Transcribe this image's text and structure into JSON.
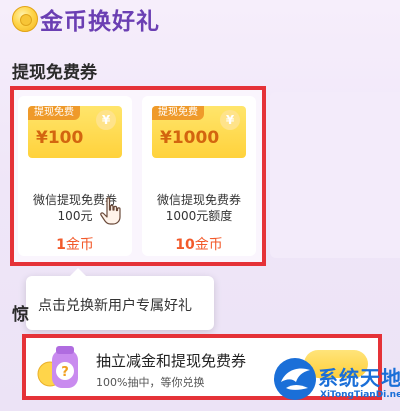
{
  "header": {
    "title": "金币换好礼",
    "icon": "coin-icon"
  },
  "section": {
    "title": "提现免费券"
  },
  "cards": [
    {
      "tag": "提现免费",
      "amount": "¥100",
      "name": "微信提现免费券",
      "sub": "100元",
      "price_num": "1",
      "price_unit": "金币"
    },
    {
      "tag": "提现免费",
      "amount": "¥1000",
      "name": "微信提现免费券",
      "sub": "1000元额度",
      "price_num": "10",
      "price_unit": "金币"
    }
  ],
  "ticket_symbol": "¥",
  "tooltip": {
    "text": "点击兑换新用户专属好礼"
  },
  "partial_section": {
    "title": "惊"
  },
  "lottery": {
    "title": "抽立减金和提现免费券",
    "sub": "100%抽中，等你兑换"
  },
  "watermark": {
    "title": "系统天地",
    "url": "XiTongTianDi.net"
  },
  "colors": {
    "accent_purple": "#6b3fb3",
    "highlight_red": "#e53238",
    "price_orange": "#f25a2b",
    "ticket_yellow": "#ffd23c",
    "watermark_blue": "#1a6fd8"
  }
}
